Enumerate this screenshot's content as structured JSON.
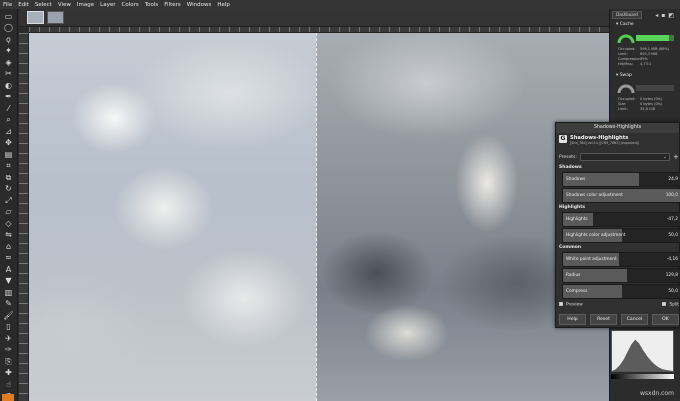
{
  "menubar": [
    "File",
    "Edit",
    "Select",
    "View",
    "Image",
    "Layer",
    "Colors",
    "Tools",
    "Filters",
    "Windows",
    "Help"
  ],
  "toolbox": {
    "tools": [
      "rect-select-icon",
      "ellipse-select-icon",
      "lasso-icon",
      "fuzzy-select-icon",
      "select-by-color-icon",
      "scissors-icon",
      "foreground-select-icon",
      "paths-icon",
      "color-picker-icon",
      "zoom-icon",
      "measure-icon",
      "move-icon",
      "align-icon",
      "crop-icon",
      "unified-transform-icon",
      "rotate-icon",
      "scale-icon",
      "shear-icon",
      "perspective-icon",
      "flip-icon",
      "cage-icon",
      "warp-icon",
      "text-icon",
      "bucket-fill-icon",
      "gradient-icon",
      "pencil-icon",
      "paintbrush-icon",
      "eraser-icon",
      "airbrush-icon",
      "ink-icon",
      "clone-icon",
      "heal-icon",
      "smudge-icon",
      "dodge-burn-icon"
    ],
    "glyphs": [
      "▭",
      "◯",
      "ϙ",
      "✦",
      "◈",
      "✂",
      "◐",
      "✒",
      "⁄",
      "⌕",
      "⊿",
      "✥",
      "▤",
      "⌗",
      "⧉",
      "↻",
      "⤢",
      "▱",
      "◇",
      "⇋",
      "⌂",
      "≈",
      "A",
      "▼",
      "▥",
      "✎",
      "🖌",
      "▯",
      "✈",
      "✑",
      "⎘",
      "✚",
      "☝",
      "◑"
    ],
    "fg_color": "#e07b1f"
  },
  "dashboard": {
    "tab": "Dashboard",
    "cache": {
      "title": "Cache",
      "rows": [
        {
          "label": "Occupied:",
          "value": "596,1 MiB (86%)"
        },
        {
          "label": "Limit:",
          "value": "695,3 MiB"
        },
        {
          "label": "Compression:",
          "value": "79%"
        },
        {
          "label": "Hit/Miss:",
          "value": "4,73:1"
        }
      ]
    },
    "swap": {
      "title": "Swap",
      "rows": [
        {
          "label": "Occupied:",
          "value": "0 bytes (0%)"
        },
        {
          "label": "Size:",
          "value": "0 bytes (0%)"
        },
        {
          "label": "Limit:",
          "value": "35,6 GiB"
        }
      ]
    }
  },
  "histogram": {
    "channel": "Value",
    "colors": [
      "#000000",
      "#ffffff"
    ]
  },
  "dialog": {
    "window_title": "Shadows-Highlights",
    "name": "Shadows-Highlights",
    "subtitle": "[Shd_78d].xcf-14 ([CR9_7863] (exported))",
    "presets_label": "Presets:",
    "groups": {
      "shadows": "Shadows",
      "highlights": "Highlights",
      "common": "Common"
    },
    "sliders": {
      "shadows": {
        "label": "Shadows",
        "value": "24,9",
        "level": 0.65
      },
      "shadows_color": {
        "label": "Shadows color adjustment",
        "value": "100,0",
        "level": 1.0
      },
      "highlights": {
        "label": "Highlights",
        "value": "-47,2",
        "level": 0.26
      },
      "highlights_color": {
        "label": "Highlights color adjustment",
        "value": "50,0",
        "level": 0.5
      },
      "whitepoint": {
        "label": "White point adjustment",
        "value": "-4,16",
        "level": 0.48
      },
      "radius": {
        "label": "Radius",
        "value": "129,8",
        "level": 0.55
      },
      "compress": {
        "label": "Compress",
        "value": "50,0",
        "level": 0.5
      }
    },
    "preview_label": "Preview",
    "split_label": "Split",
    "buttons": {
      "help": "Help",
      "reset": "Reset",
      "cancel": "Cancel",
      "ok": "OK"
    }
  },
  "watermark": "wsxdn.com"
}
